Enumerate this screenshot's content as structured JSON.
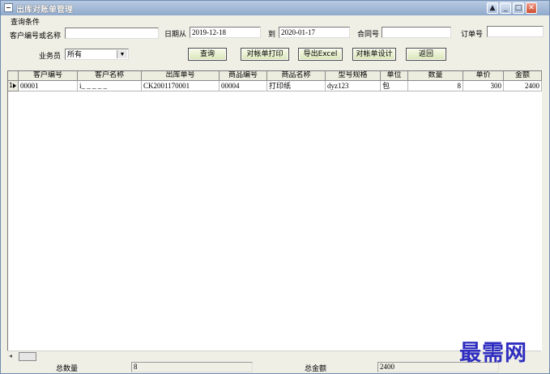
{
  "window": {
    "title": "出库对账单管理",
    "controls": {
      "minimize": "_",
      "restore": "□",
      "close": "✕",
      "help": "▲"
    }
  },
  "query": {
    "group_label": "查询条件",
    "customer_label": "客户编号或名称",
    "customer_value": "",
    "date_from_label": "日期从",
    "date_from_value": "2019-12-18",
    "date_to_label": "到",
    "date_to_value": "2020-01-17",
    "contract_label": "合同号",
    "contract_value": "",
    "order_label": "订单号",
    "order_value": "",
    "salesman_label": "业务员",
    "salesman_value": "所有"
  },
  "toolbar": {
    "query": "查询",
    "print": "对帐单打印",
    "export": "导出Excel",
    "design": "对帐单设计",
    "back": "返回"
  },
  "table": {
    "columns": [
      "客户编号",
      "客户名称",
      "出库单号",
      "商品编号",
      "商品名称",
      "型号规格",
      "单位",
      "数量",
      "单价",
      "金额"
    ],
    "rows": [
      {
        "index": "1",
        "cells": [
          "00001",
          "i_ _ _ _ _",
          "CK2001170001",
          "00004",
          "打印纸",
          "dyz123",
          "包",
          "8",
          "300",
          "2400"
        ]
      }
    ]
  },
  "footer": {
    "total_qty_label": "总数量",
    "total_qty_value": "8",
    "total_amount_label": "总金额",
    "total_amount_value": "2400"
  },
  "watermark": "最需网",
  "colors": {
    "title_bar": "#9ab1d1",
    "button_face": "#e4edc9",
    "watermark": "#2f2ec0",
    "window_bg": "#f0efe6"
  }
}
